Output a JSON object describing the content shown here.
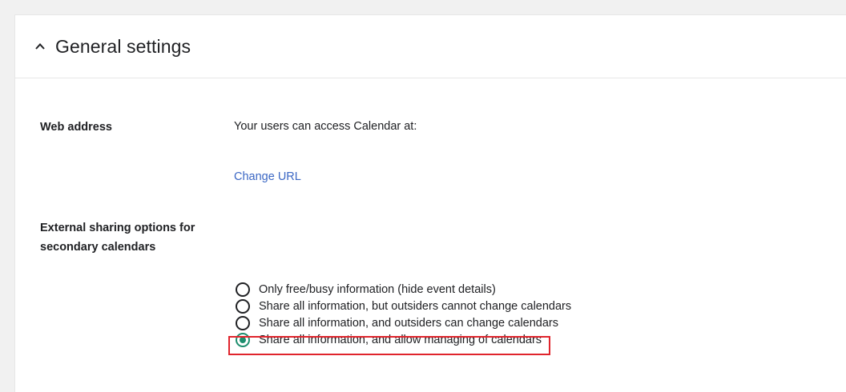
{
  "header": {
    "title": "General settings",
    "chevron_icon": "chevron-up-icon"
  },
  "web_address": {
    "label": "Web address",
    "description": "Your users can access Calendar at:",
    "change_url_link": "Change URL"
  },
  "external_sharing": {
    "label_line1": "External sharing options for",
    "label_line2": "secondary calendars",
    "options": [
      {
        "label": "Only free/busy information (hide event details)",
        "selected": false
      },
      {
        "label": "Share all information, but outsiders cannot change calendars",
        "selected": false
      },
      {
        "label": "Share all information, and outsiders can change calendars",
        "selected": false
      },
      {
        "label": "Share all information, and allow managing of calendars",
        "selected": true
      }
    ]
  },
  "colors": {
    "link": "#3b67c4",
    "radio_selected": "#1e8e6e",
    "highlight_border": "#e0242c"
  }
}
